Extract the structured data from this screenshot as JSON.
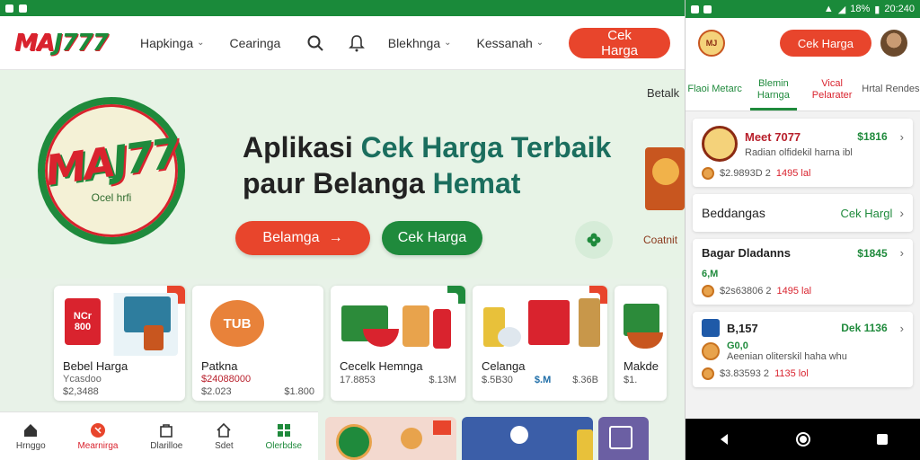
{
  "desktop": {
    "brand": {
      "left": "MA",
      "right": "J777"
    },
    "nav": [
      {
        "label": "Hapkinga",
        "has_chevron": true
      },
      {
        "label": "Cearinga",
        "has_chevron": false
      },
      {
        "label": "Blekhnga",
        "has_chevron": true
      },
      {
        "label": "Kessanah",
        "has_chevron": true
      }
    ],
    "cta": "Cek Harga",
    "hero": {
      "logo_mark_left": "MA",
      "logo_mark_right": "J77",
      "logo_sub": "Ocel hrfi",
      "title_line1_a": "Aplikasi ",
      "title_line1_b": "Cek Harga Terbaik",
      "title_line2_a": "paur Belanga ",
      "title_line2_b": "Hemat",
      "btn_primary": "Belamga",
      "btn_primary_arrow": "→",
      "btn_secondary": "Cek Harga",
      "side_label": "Betalk",
      "side_text": "Coatnit"
    },
    "cards": [
      {
        "title": "Bebel Harga",
        "sub": "Ycasdoo",
        "price_left": "$2,3488",
        "price_right": "",
        "badge": "NCr 800",
        "ribbon": "red"
      },
      {
        "title": "Patkna",
        "sub": "$24088000",
        "price_left": "$2.023",
        "price_right": "$1.800",
        "badge": "TUB",
        "ribbon": ""
      },
      {
        "title": "Cecelk Hemnga",
        "sub": "",
        "price_left": "17.8853",
        "price_right": "$.13M",
        "badge": "",
        "ribbon": "green"
      },
      {
        "title": "Celanga",
        "sub": "",
        "price_left": "$.5B30",
        "price_right": "$.36B",
        "price_right2": "$.M",
        "badge": "",
        "ribbon": "red"
      },
      {
        "title": "Makde",
        "sub": "",
        "price_left": "$1.",
        "price_right": "",
        "badge": "",
        "ribbon": ""
      }
    ],
    "bottom_nav": [
      {
        "label": "Hrnggo",
        "icon": "home-icon",
        "state": "normal"
      },
      {
        "label": "Mearnirga",
        "icon": "tag-icon",
        "state": "active"
      },
      {
        "label": "Dlarilloe",
        "icon": "bag-icon",
        "state": "normal"
      },
      {
        "label": "Sdet",
        "icon": "house-icon",
        "state": "normal"
      },
      {
        "label": "Olerbdse",
        "icon": "grid-icon",
        "state": "green"
      }
    ]
  },
  "phone": {
    "status": {
      "battery": "18%",
      "time": "20:240"
    },
    "header": {
      "cta": "Cek Harga",
      "logo_text": "MJ"
    },
    "tabs": [
      {
        "label": "Flaoi Metarc",
        "state": "normal"
      },
      {
        "label": "Blemin Harnga",
        "state": "active"
      },
      {
        "label": "Vical Pelarater",
        "state": "red"
      },
      {
        "label": "Hrtal Rendes",
        "state": "normal"
      }
    ],
    "items": [
      {
        "name": "Meet 7077",
        "price": "$1816",
        "desc": "Radian olfidekil harna ibl",
        "meta_left": "$2.9893D 2",
        "meta_right": "1495 lal",
        "thumb": true
      },
      {
        "name": "Beddangas",
        "link": "Cek Hargl",
        "simple": true
      },
      {
        "name": "Bagar Dladanns",
        "price": "$1845",
        "badge": "6,M",
        "meta_left": "$2s63806 2",
        "meta_right": "1495 lal"
      },
      {
        "name": "B,157",
        "price": "Dek 1136",
        "badge": "G0,0",
        "desc": "Aeenian oliterskil haha whu",
        "meta_left": "$3.83593 2",
        "meta_right": "1135 lol"
      }
    ]
  },
  "colors": {
    "green": "#1f8a3c",
    "red": "#e8452c",
    "dark_red": "#d9232e"
  }
}
